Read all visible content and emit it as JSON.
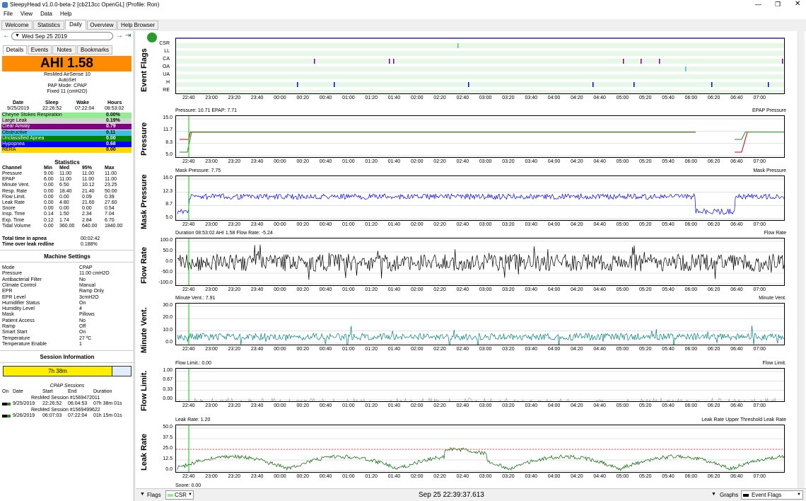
{
  "window": {
    "title": "SleepyHead v1.0.0-beta-2 [cb213cc OpenGL] (Profile: Ron)"
  },
  "menu": [
    "File",
    "View",
    "Data",
    "Help"
  ],
  "tabs": [
    "Welcome",
    "Statistics",
    "Daily",
    "Overview",
    "Help Browser"
  ],
  "date_nav": {
    "date": "Wed Sep 25 2019"
  },
  "subtabs": [
    "Details",
    "Events",
    "Notes",
    "Bookmarks"
  ],
  "ahi": {
    "label": "AHI 1.58",
    "color": "#ff8c00"
  },
  "machine": [
    "ResMed AirSense 10",
    "AutoSet",
    "PAP Mode: CPAP",
    "Fixed 11 (cmH2O)"
  ],
  "sleep_header": [
    "Date",
    "Sleep",
    "Wake",
    "Hours"
  ],
  "sleep_row": [
    "9/25/2019",
    "22:26:52",
    "07:22:04",
    "08:53:02"
  ],
  "indices": [
    {
      "name": "Cheyne Stokes Respiration",
      "value": "0.00%",
      "color": "#90ee90"
    },
    {
      "name": "Large Leak",
      "value": "0.19%",
      "color": "#d3d3d3"
    },
    {
      "name": "Clear Airway",
      "value": "0.79",
      "color": "#800080",
      "light": true
    },
    {
      "name": "Obstructive",
      "value": "0.11",
      "color": "#40c0e0"
    },
    {
      "name": "Unclassified Apnea",
      "value": "0.00",
      "color": "#008000",
      "light": true
    },
    {
      "name": "Hypopnea",
      "value": "0.68",
      "color": "#0000ff",
      "light": true
    },
    {
      "name": "RERA",
      "value": "0.00",
      "color": "#ffd700"
    }
  ],
  "stats_title": "Statistics",
  "stats_header": [
    "Channel",
    "Min",
    "Med",
    "95%",
    "Max"
  ],
  "stats": [
    [
      "Pressure",
      "9.00",
      "11.00",
      "11.00",
      "11.00"
    ],
    [
      "EPAP",
      "6.00",
      "11.00",
      "11.00",
      "11.00"
    ],
    [
      "Minute Vent.",
      "0.00",
      "6.50",
      "10.12",
      "23.25"
    ],
    [
      "Resp. Rate",
      "0.00",
      "18.40",
      "21.40",
      "50.00"
    ],
    [
      "Flow Limit.",
      "0.00",
      "0.00",
      "0.09",
      "0.39"
    ],
    [
      "Leak Rate",
      "0.00",
      "4.80",
      "21.60",
      "27.60"
    ],
    [
      "Snore",
      "0.00",
      "0.00",
      "0.00",
      "0.54"
    ],
    [
      "Insp. Time",
      "0.14",
      "1.50",
      "2.34",
      "7.04"
    ],
    [
      "Exp. Time",
      "0.12",
      "1.74",
      "2.84",
      "6.70"
    ],
    [
      "Tidal Volume",
      "0.00",
      "360.00",
      "640.00",
      "1840.00"
    ]
  ],
  "totals": [
    [
      "Total time in apnea",
      "00:02:42"
    ],
    [
      "Time over leak redline",
      "0.188%"
    ]
  ],
  "settings_title": "Machine Settings",
  "settings": [
    [
      "Mode",
      "CPAP"
    ],
    [
      "Pressure",
      "11.00 cmH2O"
    ],
    [
      "Antibacterial Filter",
      "No"
    ],
    [
      "Climate Control",
      "Manual"
    ],
    [
      "EPR",
      "Ramp Only"
    ],
    [
      "EPR Level",
      "3cmH2O"
    ],
    [
      "Humidifier Status",
      "On"
    ],
    [
      "Humidity Level",
      "4"
    ],
    [
      "Mask",
      "Pillows"
    ],
    [
      "Patient Access",
      "No"
    ],
    [
      "Ramp",
      "Off"
    ],
    [
      "Smart Start",
      "On"
    ],
    [
      "Temperature",
      "27 ºC"
    ],
    [
      "Temperature Enable",
      "1"
    ]
  ],
  "session_title": "Session Information",
  "session_bar": "7h 38m",
  "cpap_sessions": "CPAP Sessions",
  "session_header": [
    "On",
    "Date",
    "Start",
    "End",
    "Duration"
  ],
  "sessions": [
    {
      "name": "ResMed Session #1569472011",
      "date": "9/25/2019",
      "start": "22:26:52",
      "end": "06:04:53",
      "dur": "07h 38m 01s"
    },
    {
      "name": "ResMed Session #1569499622",
      "date": "9/26/2019",
      "start": "06:07:03",
      "end": "07:22:04",
      "dur": "01h 15m 01s"
    }
  ],
  "x_ticks": [
    "22:40",
    "23:00",
    "23:20",
    "23:40",
    "00:00",
    "00:20",
    "00:40",
    "01:00",
    "01:20",
    "01:40",
    "02:00",
    "02:20",
    "02:40",
    "03:00",
    "03:20",
    "03:40",
    "04:00",
    "04:20",
    "04:40",
    "05:00",
    "05:20",
    "05:40",
    "06:00",
    "06:20",
    "06:40",
    "07:00"
  ],
  "graphs": [
    {
      "id": "flags",
      "label": "Event Flags",
      "rows": [
        "CSR",
        "LL",
        "CA",
        "OA",
        "UA",
        "H",
        "RE"
      ]
    },
    {
      "id": "pressure",
      "label": "Pressure",
      "caption": "Pressure: 10.71 EPAP: 7.71",
      "legend": "EPAP Pressure",
      "yticks": [
        "15.0",
        "11.7",
        "8.3",
        "5.0"
      ]
    },
    {
      "id": "mask",
      "label": "Mask Pressure",
      "caption": "Mask Pressure: 7.75",
      "legend": "Mask Pressure",
      "yticks": [
        "16.0",
        "12.3",
        "8.7",
        "5.0"
      ]
    },
    {
      "id": "flow",
      "label": "Flow Rate",
      "caption": "Duration 08:53:02 AHI 1.58 Flow Rate: -5.24",
      "legend": "Flow Rate",
      "yticks": [
        "100.0",
        "50.0",
        "0.0",
        "-50.0",
        "-100.0"
      ]
    },
    {
      "id": "minvent",
      "label": "Minute Vent.",
      "caption": "Minute Vent.: 7.91",
      "legend": "Minute Vent.",
      "yticks": [
        "30.0",
        "20.0",
        "10.0",
        "0.0"
      ]
    },
    {
      "id": "flowlim",
      "label": "Flow Limit.",
      "caption": "Flow Limit.: 0.00",
      "legend": "Flow Limit.",
      "yticks": [
        "1.00",
        "0.67",
        "0.33",
        "0.00"
      ]
    },
    {
      "id": "leak",
      "label": "Leak Rate",
      "caption": "Leak Rate: 1.20",
      "legend": "Leak Rate Upper Threshold Leak Rate",
      "yticks": [
        "50.0",
        "37.5",
        "25.0",
        "12.5",
        "0.0"
      ]
    }
  ],
  "snore_caption": "Snore: 0.00",
  "bottom": {
    "flags": "Flags",
    "csr": "CSR",
    "time": "Sep 25 22:39:37.613",
    "graphs": "Graphs",
    "event_flags": "Event Flags"
  }
}
